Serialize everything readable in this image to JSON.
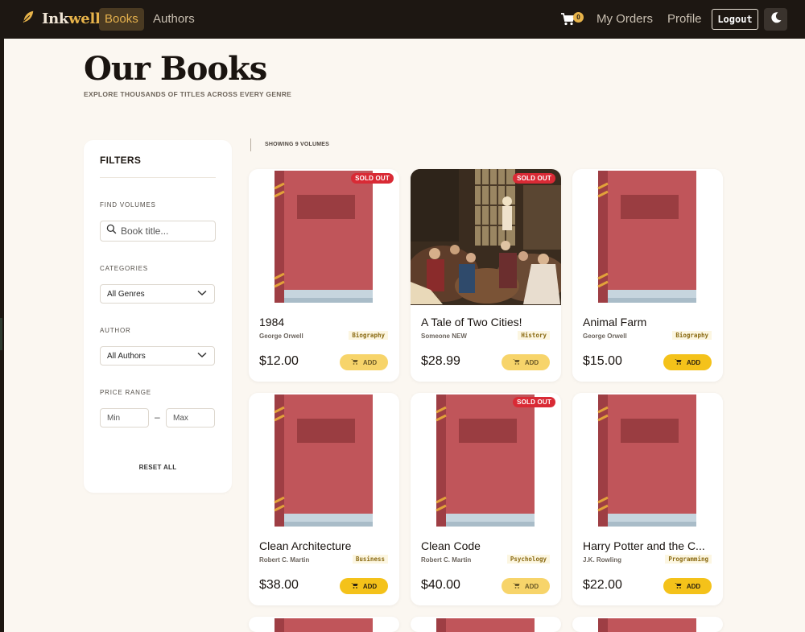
{
  "nav": {
    "brand": "Inkwell",
    "brand_part1": "Ink",
    "brand_part2": "well",
    "links": [
      "Books",
      "Authors"
    ],
    "cart_count": "0",
    "right_links": [
      "My Orders",
      "Profile"
    ],
    "logout": "Logout"
  },
  "header": {
    "title": "Our Books",
    "subtitle": "EXPLORE THOUSANDS OF TITLES ACROSS EVERY GENRE"
  },
  "filters": {
    "title": "FILTERS",
    "search_label": "FIND VOLUMES",
    "search_placeholder": "Book title...",
    "categories_label": "CATEGORIES",
    "categories_value": "All Genres",
    "author_label": "AUTHOR",
    "author_value": "All Authors",
    "price_label": "PRICE RANGE",
    "min_placeholder": "Min",
    "max_placeholder": "Max",
    "price_separator": "–",
    "reset": "RESET ALL"
  },
  "results": {
    "count_text": "SHOWING 9 VOLUMES"
  },
  "books": [
    {
      "title": "1984",
      "author": "George Orwell",
      "genre": "Biography",
      "price": "$12.00",
      "sold_out": true,
      "cover": "book-icon",
      "add": "ADD"
    },
    {
      "title": "A Tale of Two Cities!",
      "author": "Someone NEW",
      "genre": "History",
      "price": "$28.99",
      "sold_out": true,
      "cover": "painting",
      "add": "ADD"
    },
    {
      "title": "Animal Farm",
      "author": "George Orwell",
      "genre": "Biography",
      "price": "$15.00",
      "sold_out": false,
      "cover": "book-icon",
      "add": "ADD"
    },
    {
      "title": "Clean Architecture",
      "author": "Robert C. Martin",
      "genre": "Business",
      "price": "$38.00",
      "sold_out": false,
      "cover": "book-icon",
      "add": "ADD"
    },
    {
      "title": "Clean Code",
      "author": "Robert C. Martin",
      "genre": "Psychology",
      "price": "$40.00",
      "sold_out": true,
      "cover": "book-icon",
      "add": "ADD"
    },
    {
      "title": "Harry Potter and the C...",
      "author": "J.K. Rowling",
      "genre": "Programming",
      "price": "$22.00",
      "sold_out": false,
      "cover": "book-icon",
      "add": "ADD"
    }
  ],
  "sold_out_label": "SOLD OUT",
  "colors": {
    "nav_bg": "#1d1712",
    "accent": "#e7b34a",
    "add_button": "#f4c21a",
    "sold_out": "#d92a35",
    "book_cover": "#c0555a"
  }
}
